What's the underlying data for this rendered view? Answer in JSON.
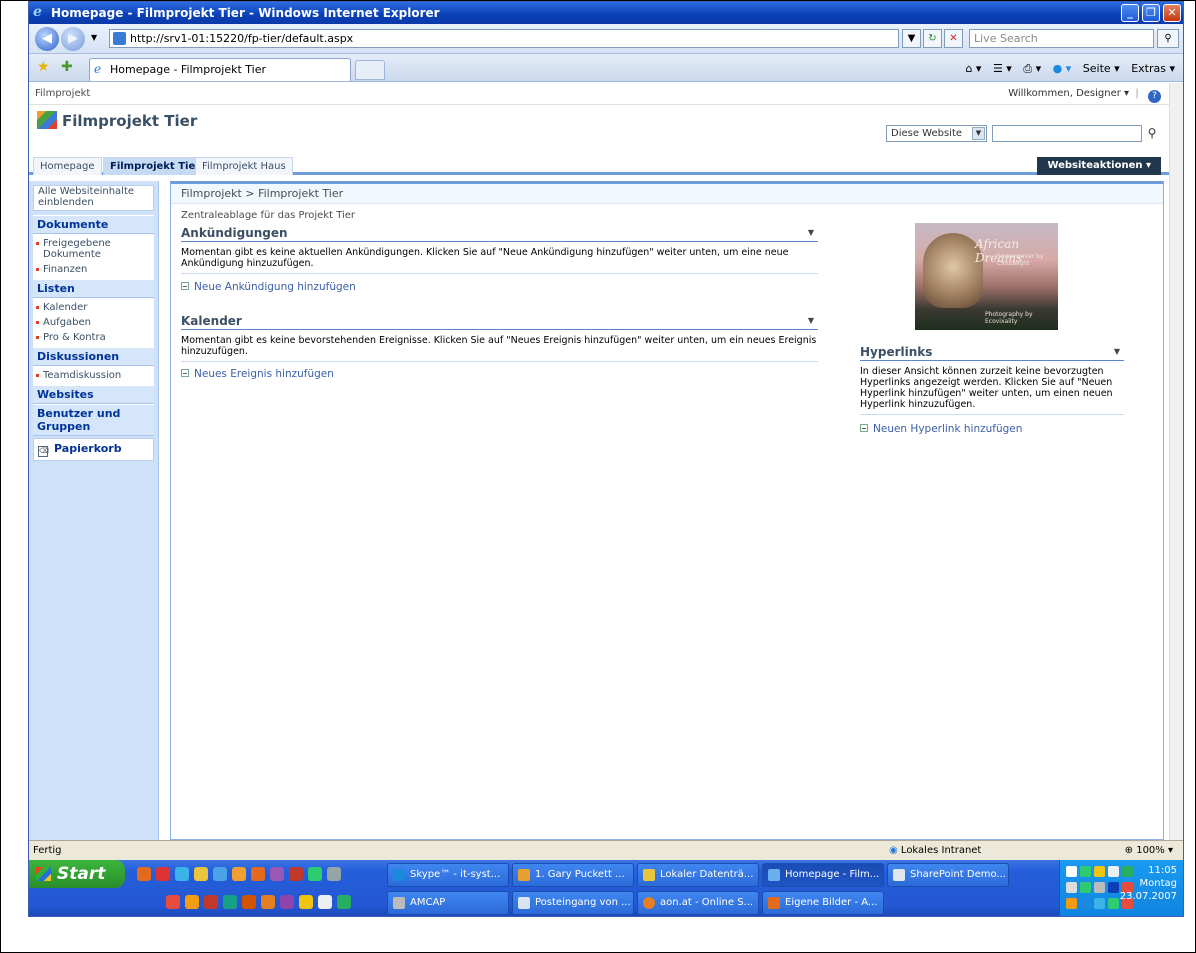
{
  "window": {
    "title": "Homepage - Filmprojekt Tier - Windows Internet Explorer",
    "min_glyph": "_",
    "max_glyph": "❐",
    "close_glyph": "✕"
  },
  "addressbar": {
    "url": "http://srv1-01:15220/fp-tier/default.aspx",
    "search_placeholder": "Live Search"
  },
  "tabs": {
    "active_tab": "Homepage - Filmprojekt Tier"
  },
  "commandbar": {
    "page": "Seite ▾",
    "extras": "Extras ▾"
  },
  "sharepoint": {
    "global_breadcrumb": "Filmprojekt",
    "welcome": "Willkommen, Designer ▾",
    "site_title": "Filmprojekt Tier",
    "search_scope": "Diese Website",
    "topnav": [
      "Homepage",
      "Filmprojekt Tier",
      "Filmprojekt Haus"
    ],
    "site_actions": "Websiteaktionen ▾",
    "quicklaunch": {
      "all_content": "Alle Websiteinhalte einblenden",
      "sections": [
        {
          "title": "Dokumente",
          "items": [
            "Freigegebene Dokumente",
            "Finanzen"
          ]
        },
        {
          "title": "Listen",
          "items": [
            "Kalender",
            "Aufgaben",
            "Pro & Kontra"
          ]
        },
        {
          "title": "Diskussionen",
          "items": [
            "Teamdiskussion"
          ]
        },
        {
          "title": "Websites",
          "items": []
        },
        {
          "title": "Benutzer und Gruppen",
          "items": []
        }
      ],
      "recycle_bin": "Papierkorb"
    },
    "breadcrumb": "Filmprojekt > Filmprojekt Tier",
    "page_description": "Zentraleablage für das Projekt Tier",
    "announcements": {
      "title": "Ankündigungen",
      "body": "Momentan gibt es keine aktuellen Ankündigungen. Klicken Sie auf \"Neue Ankündigung hinzufügen\" weiter unten, um eine neue Ankündigung hinzuzufügen.",
      "add_link": "Neue Ankündigung hinzufügen"
    },
    "calendar": {
      "title": "Kalender",
      "body": "Momentan gibt es keine bevorstehenden Ereignisse. Klicken Sie auf \"Neues Ereignis hinzufügen\" weiter unten, um ein neues Ereignis hinzuzufügen.",
      "add_link": "Neues Ereignis hinzufügen"
    },
    "image": {
      "caption1": "African Dreams",
      "caption2": "Screensaver by Cloudeight",
      "caption3": "Photography by Ecovixality"
    },
    "links": {
      "title": "Hyperlinks",
      "body": "In dieser Ansicht können zurzeit keine bevorzugten Hyperlinks angezeigt werden. Klicken Sie auf \"Neuen Hyperlink hinzufügen\" weiter unten, um einen neuen Hyperlink hinzuzufügen.",
      "add_link": "Neuen Hyperlink hinzufügen"
    }
  },
  "statusbar": {
    "status": "Fertig",
    "zone": "Lokales Intranet",
    "zoom": "100%"
  },
  "taskbar": {
    "start": "Start",
    "tasks_row1": [
      "Skype™ - it-syst...",
      "1. Gary Puckett ...",
      "Lokaler Datenträ...",
      "Homepage - Film...",
      "SharePoint Demo..."
    ],
    "tasks_row2": [
      "AMCAP",
      "Posteingang von ...",
      "aon.at - Online S...",
      "Eigene Bilder - A..."
    ],
    "clock_time": "11:05",
    "clock_day": "Montag",
    "clock_date": "23.07.2007"
  },
  "colors": {
    "titlebar": "#0a3fb5",
    "site_actions": "#21374c",
    "quicklaunch": "#cfe1f8",
    "link": "#3b5ea6"
  }
}
